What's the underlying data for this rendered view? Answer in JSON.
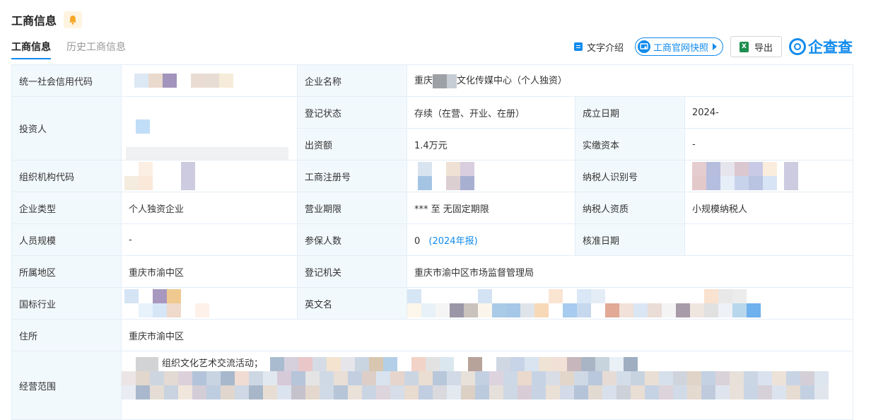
{
  "header": {
    "title": "工商信息"
  },
  "tabs": [
    {
      "label": "工商信息",
      "active": true
    },
    {
      "label": "历史工商信息",
      "active": false
    }
  ],
  "toolbar": {
    "text_intro": "文字介绍",
    "snapshot": "工商官网快照",
    "export": "导出",
    "brand": "企查查"
  },
  "colors": {
    "accent": "#128bed",
    "label_bg": "#f2f9fc",
    "border": "#e4eef6",
    "bell": "#f5a623"
  },
  "table": {
    "credit_code": {
      "label": "统一社会信用代码"
    },
    "company_name": {
      "label": "企业名称",
      "value_prefix": "重庆",
      "value_suffix": "文化传媒中心（个人独资）"
    },
    "investor": {
      "label": "投资人"
    },
    "reg_status": {
      "label": "登记状态",
      "value": "存续（在营、开业、在册）"
    },
    "established": {
      "label": "成立日期",
      "value": "2024-"
    },
    "capital_contrib": {
      "label": "出资额",
      "value": "1.4万元"
    },
    "paid_capital": {
      "label": "实缴资本",
      "value": "-"
    },
    "org_code": {
      "label": "组织机构代码"
    },
    "reg_no": {
      "label": "工商注册号"
    },
    "taxpayer_id": {
      "label": "纳税人识别号"
    },
    "company_type": {
      "label": "企业类型",
      "value": "个人独资企业"
    },
    "business_term": {
      "label": "营业期限",
      "value": "*** 至 无固定期限"
    },
    "taxpayer_qual": {
      "label": "纳税人资质",
      "value": "小规模纳税人"
    },
    "staff_size": {
      "label": "人员规模",
      "value": "-"
    },
    "insured": {
      "label": "参保人数",
      "value": "0",
      "report": "(2024年报)"
    },
    "approval_date": {
      "label": "核准日期",
      "value": ""
    },
    "region": {
      "label": "所属地区",
      "value": "重庆市渝中区"
    },
    "authority": {
      "label": "登记机关",
      "value": "重庆市渝中区市场监督管理局"
    },
    "industry": {
      "label": "国标行业"
    },
    "english_name": {
      "label": "英文名"
    },
    "address": {
      "label": "住所",
      "value": "重庆市渝中区"
    },
    "scope": {
      "label": "经营范围",
      "value": "组织文化艺术交流活动；"
    }
  }
}
